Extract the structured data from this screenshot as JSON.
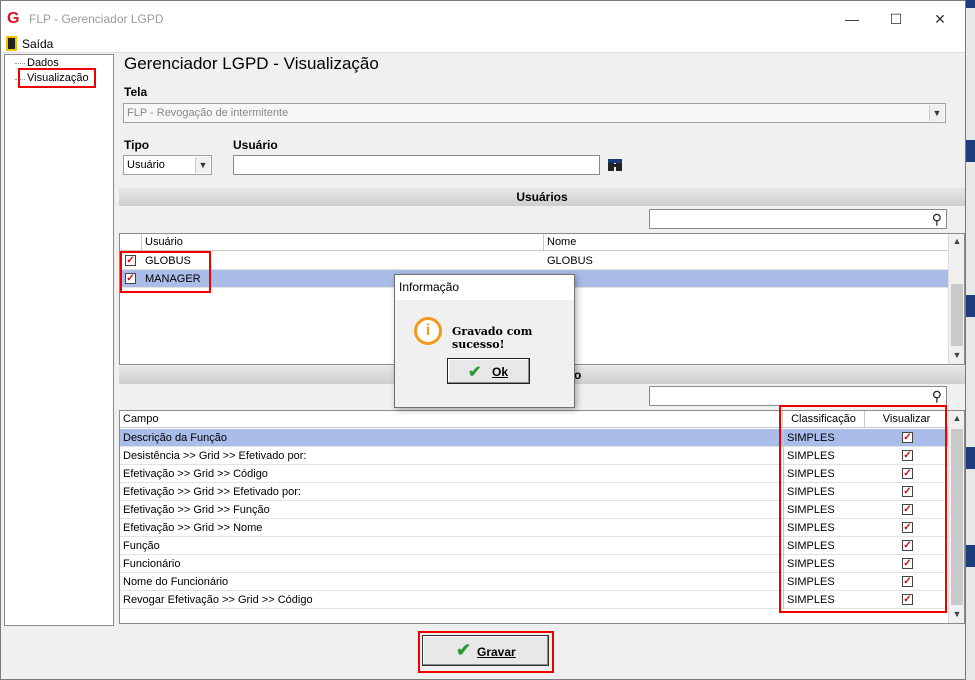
{
  "window": {
    "title": "FLP - Gerenciador LGPD",
    "logo_letter": "G",
    "minimize": "—",
    "maximize": "☐",
    "close": "✕"
  },
  "menu": {
    "exit_label": "Saída"
  },
  "tree": {
    "items": [
      "Dados",
      "Visualização"
    ]
  },
  "heading": "Gerenciador LGPD - Visualização",
  "form": {
    "tela_label": "Tela",
    "tela_value": "FLP - Revogação de intermitente",
    "tipo_label": "Tipo",
    "tipo_value": "Usuário",
    "usuario_label": "Usuário",
    "usuario_value": ""
  },
  "users_section": {
    "title": "Usuários",
    "columns": [
      "Usuário",
      "Nome"
    ],
    "rows": [
      {
        "usuario": "GLOBUS",
        "nome": "GLOBUS",
        "checked": true,
        "selected": false
      },
      {
        "usuario": "MANAGER",
        "nome": "",
        "checked": true,
        "selected": true
      }
    ]
  },
  "fields_section": {
    "title_tail": "o",
    "columns": [
      "Campo",
      "Classificação",
      "Visualizar"
    ],
    "rows": [
      {
        "campo": "Descrição da Função",
        "classificacao": "SIMPLES",
        "visualizar": true,
        "selected": true
      },
      {
        "campo": "Desistência >> Grid >> Efetivado por:",
        "classificacao": "SIMPLES",
        "visualizar": true,
        "selected": false
      },
      {
        "campo": "Efetivação >> Grid >> Código",
        "classificacao": "SIMPLES",
        "visualizar": true,
        "selected": false
      },
      {
        "campo": "Efetivação >> Grid >> Efetivado por:",
        "classificacao": "SIMPLES",
        "visualizar": true,
        "selected": false
      },
      {
        "campo": "Efetivação >> Grid >> Função",
        "classificacao": "SIMPLES",
        "visualizar": true,
        "selected": false
      },
      {
        "campo": "Efetivação >> Grid >> Nome",
        "classificacao": "SIMPLES",
        "visualizar": true,
        "selected": false
      },
      {
        "campo": "Função",
        "classificacao": "SIMPLES",
        "visualizar": true,
        "selected": false
      },
      {
        "campo": "Funcionário",
        "classificacao": "SIMPLES",
        "visualizar": true,
        "selected": false
      },
      {
        "campo": "Nome do Funcionário",
        "classificacao": "SIMPLES",
        "visualizar": true,
        "selected": false
      },
      {
        "campo": "Revogar Efetivação >> Grid >> Código",
        "classificacao": "SIMPLES",
        "visualizar": true,
        "selected": false
      }
    ]
  },
  "dialog": {
    "title": "Informação",
    "icon": "info-icon",
    "message": "Gravado com sucesso!",
    "ok_label": "Ok"
  },
  "save_button": {
    "label": "Gravar"
  },
  "colors": {
    "selection": "#a9bde8",
    "highlight_box": "#ee0000",
    "check_green": "#2a9a3a",
    "info_orange": "#f39a1e"
  }
}
